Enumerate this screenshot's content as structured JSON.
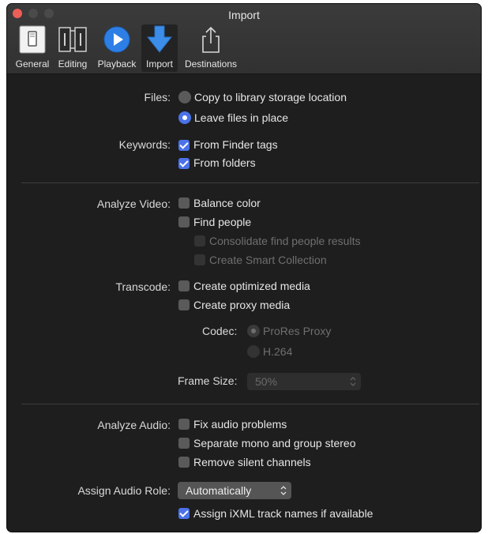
{
  "window": {
    "title": "Import"
  },
  "toolbar": {
    "tabs": [
      {
        "label": "General",
        "icon": "switch-icon"
      },
      {
        "label": "Editing",
        "icon": "film-strip-icon"
      },
      {
        "label": "Playback",
        "icon": "play-icon"
      },
      {
        "label": "Import",
        "icon": "import-arrow-icon",
        "selected": true
      },
      {
        "label": "Destinations",
        "icon": "share-icon"
      }
    ]
  },
  "files": {
    "label": "Files:",
    "options": [
      "Copy to library storage location",
      "Leave files in place"
    ],
    "selected": "Leave files in place"
  },
  "keywords": {
    "label": "Keywords:",
    "options": [
      {
        "label": "From Finder tags",
        "checked": true
      },
      {
        "label": "From folders",
        "checked": true
      }
    ]
  },
  "analyze_video": {
    "label": "Analyze Video:",
    "options": [
      {
        "label": "Balance color",
        "checked": false
      },
      {
        "label": "Find people",
        "checked": false
      },
      {
        "label": "Consolidate find people results",
        "checked": false,
        "disabled": true
      },
      {
        "label": "Create Smart Collection",
        "checked": false,
        "disabled": true
      }
    ]
  },
  "transcode": {
    "label": "Transcode:",
    "options": [
      {
        "label": "Create optimized media",
        "checked": false
      },
      {
        "label": "Create proxy media",
        "checked": false
      }
    ],
    "codec_label": "Codec:",
    "codec_options": [
      "ProRes Proxy",
      "H.264"
    ],
    "codec_selected": "ProRes Proxy",
    "frame_size_label": "Frame Size:",
    "frame_size_value": "50%"
  },
  "analyze_audio": {
    "label": "Analyze Audio:",
    "options": [
      {
        "label": "Fix audio problems",
        "checked": false
      },
      {
        "label": "Separate mono and group stereo",
        "checked": false
      },
      {
        "label": "Remove silent channels",
        "checked": false
      }
    ]
  },
  "audio_role": {
    "label": "Assign Audio Role:",
    "value": "Automatically",
    "ixml_label": "Assign iXML track names if available",
    "ixml_checked": true
  },
  "colors": {
    "accent": "#4b72e8",
    "background": "#1e1e1e",
    "close": "#ec5f57"
  }
}
